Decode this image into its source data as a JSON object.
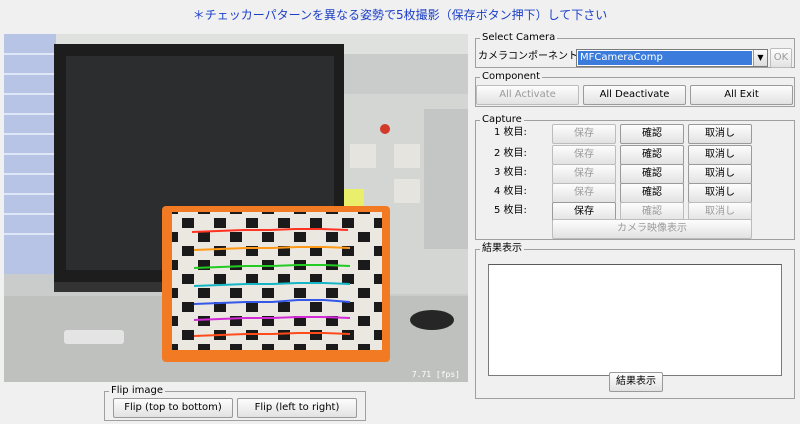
{
  "instruction": "＊チェッカーパターンを異なる姿勢で5枚撮影（保存ボタン押下）して下さい",
  "camera_view": {
    "fps_text": "7.71 [fps]"
  },
  "flip": {
    "title": "Flip image",
    "top_bottom_label": "Flip (top to bottom)",
    "left_right_label": "Flip (left to right)"
  },
  "select_camera": {
    "title": "Select Camera",
    "component_label": "カメラコンポーネント",
    "component_value": "MFCameraComp",
    "ok_label": "OK"
  },
  "component": {
    "title": "Component",
    "activate_label": "All Activate",
    "deactivate_label": "All Deactivate",
    "exit_label": "All Exit"
  },
  "capture": {
    "title": "Capture",
    "rows": [
      {
        "label": "1 枚目:",
        "save": "保存",
        "confirm": "確認",
        "cancel": "取消し"
      },
      {
        "label": "2 枚目:",
        "save": "保存",
        "confirm": "確認",
        "cancel": "取消し"
      },
      {
        "label": "3 枚目:",
        "save": "保存",
        "confirm": "確認",
        "cancel": "取消し"
      },
      {
        "label": "4 枚目:",
        "save": "保存",
        "confirm": "確認",
        "cancel": "取消し"
      },
      {
        "label": "5 枚目:",
        "save": "保存",
        "confirm": "確認",
        "cancel": "取消し"
      }
    ],
    "show_camera_label": "カメラ映像表示"
  },
  "result": {
    "title": "結果表示",
    "show_button_label": "結果表示"
  },
  "colors": {
    "instruction": "#1c3fc8",
    "combo_selected": "#3a7bdb"
  }
}
